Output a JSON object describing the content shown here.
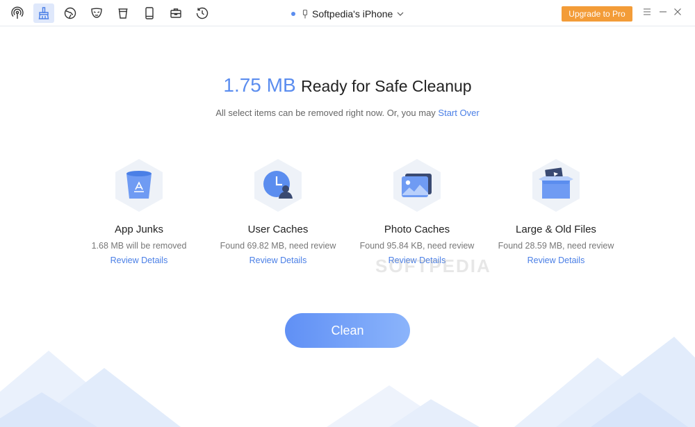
{
  "toolbar": {
    "tools": [
      {
        "icon": "podcast-icon"
      },
      {
        "icon": "broom-cleanup-icon",
        "active": true
      },
      {
        "icon": "internet-globe-icon"
      },
      {
        "icon": "privacy-mask-icon"
      },
      {
        "icon": "trash-bin-icon"
      },
      {
        "icon": "phone-icon"
      },
      {
        "icon": "toolbox-icon"
      },
      {
        "icon": "history-clock-icon"
      }
    ],
    "device_name": "Softpedia's iPhone",
    "upgrade_label": "Upgrade to Pro"
  },
  "summary": {
    "size": "1.75 MB",
    "title": "Ready for Safe Cleanup",
    "subtitle": "All select items can be removed right now. Or, you may",
    "start_over": "Start Over"
  },
  "categories": [
    {
      "title": "App Junks",
      "desc": "1.68 MB will be removed",
      "link": "Review Details",
      "icon": "app-junk-bin-icon"
    },
    {
      "title": "User Caches",
      "desc": "Found 69.82 MB, need review",
      "link": "Review Details",
      "icon": "user-cache-clock-icon"
    },
    {
      "title": "Photo Caches",
      "desc": "Found 95.84 KB, need review",
      "link": "Review Details",
      "icon": "photo-cache-icon"
    },
    {
      "title": "Large & Old Files",
      "desc": "Found 28.59 MB, need review",
      "link": "Review Details",
      "icon": "large-files-box-icon"
    }
  ],
  "watermark": "SOFTPEDIA",
  "clean_label": "Clean",
  "colors": {
    "accent": "#5b8def",
    "upgrade": "#f39c38",
    "link": "#4a7fe6"
  }
}
